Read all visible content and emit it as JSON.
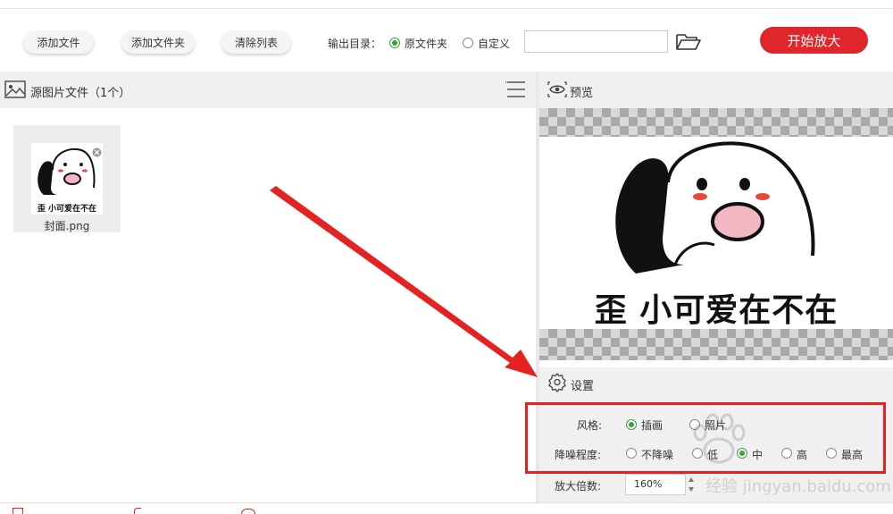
{
  "toolbar": {
    "add_file": "添加文件",
    "add_folder": "添加文件夹",
    "clear_list": "清除列表",
    "output_dir_label": "输出目录：",
    "output_original": "原文件夹",
    "output_custom": "自定义",
    "output_path_value": "",
    "start_button": "开始放大"
  },
  "source": {
    "title": "源图片文件（1个）",
    "files": [
      {
        "name": "封面.png",
        "image_caption": "歪 小可爱在不在"
      }
    ]
  },
  "preview": {
    "title": "预览",
    "image_caption": "歪 小可爱在不在"
  },
  "settings": {
    "title": "设置",
    "style_label": "风格:",
    "style_options": [
      "插画",
      "照片"
    ],
    "style_selected": "插画",
    "denoise_label": "降噪程度:",
    "denoise_options": [
      "不降噪",
      "低",
      "中",
      "高",
      "最高"
    ],
    "denoise_selected": "中",
    "scale_label": "放大倍数:",
    "scale_value": "160%"
  },
  "watermark": "经验 jingyan.baidu.com",
  "colors": {
    "accent_red": "#e0262a",
    "radio_green": "#3aa23a",
    "annotation_red": "#e52222"
  }
}
